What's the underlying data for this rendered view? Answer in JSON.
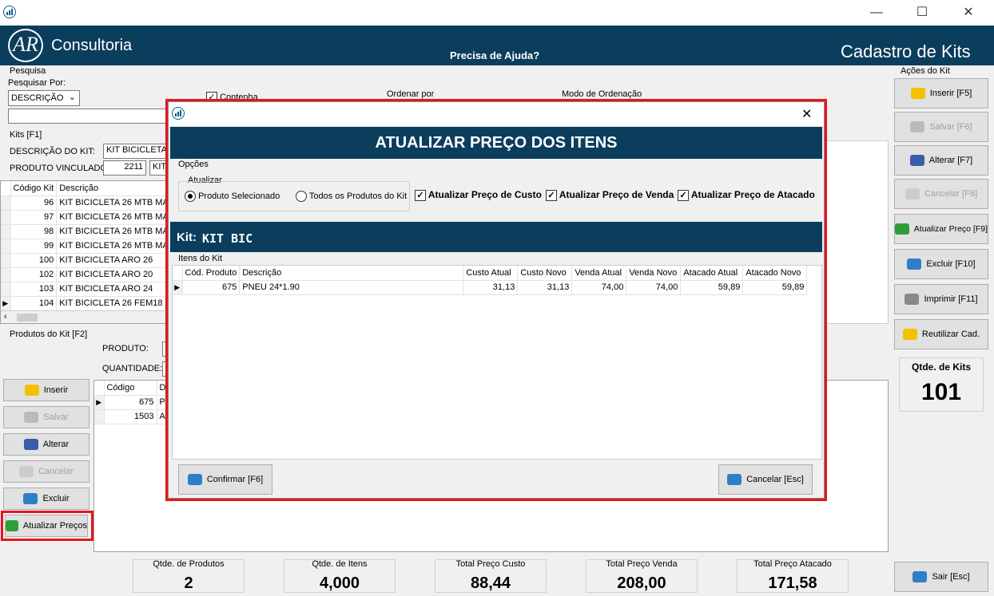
{
  "window": {
    "minimize": "—",
    "maximize": "☐",
    "close": "✕"
  },
  "header": {
    "brand": "Consultoria",
    "logo_text": "AR",
    "help": "Precisa de Ajuda?",
    "title": "Cadastro de Kits"
  },
  "search": {
    "group": "Pesquisa",
    "by_label": "Pesquisar Por:",
    "by_value": "DESCRIÇÃO",
    "contains_label": "Contenha",
    "order_label": "Ordenar por",
    "order_mode_label": "Modo de Ordenação"
  },
  "kits": {
    "group": "Kits [F1]",
    "desc_label": "DESCRIÇÃO DO KIT:",
    "desc_value": "KIT BICICLETA 2",
    "prod_label": "PRODUTO VINCULADO:",
    "prod_code": "2211",
    "prod_desc": "KIT",
    "columns": [
      "Código Kit",
      "Descrição"
    ],
    "rows": [
      {
        "code": "96",
        "desc": "KIT BICICLETA 26 MTB MASC"
      },
      {
        "code": "97",
        "desc": "KIT BICICLETA 26 MTB MASC"
      },
      {
        "code": "98",
        "desc": "KIT BICICLETA 26 MTB MASC"
      },
      {
        "code": "99",
        "desc": "KIT BICICLETA 26 MTB MASC"
      },
      {
        "code": "100",
        "desc": "KIT BICICLETA ARO 26"
      },
      {
        "code": "102",
        "desc": "KIT BICICLETA ARO 20"
      },
      {
        "code": "103",
        "desc": "KIT BICICLETA ARO 24"
      },
      {
        "code": "104",
        "desc": "KIT BICICLETA 26 FEM18 MA"
      }
    ]
  },
  "products": {
    "group": "Produtos do Kit [F2]",
    "product_label": "PRODUTO:",
    "qty_label": "QUANTIDADE:",
    "columns": [
      "Código",
      "De"
    ],
    "rows": [
      {
        "code": "675",
        "desc": "PN"
      },
      {
        "code": "1503",
        "desc": "AR"
      }
    ]
  },
  "left_buttons": {
    "insert": "Inserir",
    "save": "Salvar",
    "edit": "Alterar",
    "cancel": "Cancelar",
    "delete": "Excluir",
    "update_prices": "Atualizar Preços"
  },
  "actions": {
    "group": "Ações do Kit",
    "insert": "Inserir    [F5]",
    "save": "Salvar     [F6]",
    "edit": "Alterar    [F7]",
    "cancel": "Cancelar [F8]",
    "update_price": "Atualizar Preço [F9]",
    "delete": "Excluir    [F10]",
    "print": "Imprimir [F11]",
    "reuse": "Reutilizar Cad.",
    "qty_label": "Qtde. de Kits",
    "qty_value": "101",
    "exit": "Sair [Esc]"
  },
  "totals": [
    {
      "label": "Qtde. de Produtos",
      "value": "2"
    },
    {
      "label": "Qtde. de Itens",
      "value": "4,000"
    },
    {
      "label": "Total Preço Custo",
      "value": "88,44"
    },
    {
      "label": "Total Preço Venda",
      "value": "208,00"
    },
    {
      "label": "Total Preço Atacado",
      "value": "171,58"
    }
  ],
  "modal": {
    "close": "✕",
    "title": "ATUALIZAR PREÇO DOS ITENS",
    "options_label": "Opções",
    "update_label": "Atualizar",
    "radio_selected": "Produto Selecionado",
    "radio_all": "Todos os Produtos do Kit",
    "chk_cost": "Atualizar Preço de Custo",
    "chk_sale": "Atualizar Preço de Venda",
    "chk_wholesale": "Atualizar Preço de Atacado",
    "kit_label": "Kit:",
    "kit_value": "KIT BIC",
    "items_label": "Itens do Kit",
    "columns": [
      "Cód. Produto",
      "Descrição",
      "Custo Atual",
      "Custo Novo",
      "Venda Atual",
      "Venda Novo",
      "Atacado Atual",
      "Atacado Novo"
    ],
    "rows": [
      {
        "code": "675",
        "desc": "PNEU 24*1.90",
        "cost_cur": "31,13",
        "cost_new": "31,13",
        "sale_cur": "74,00",
        "sale_new": "74,00",
        "whole_cur": "59,89",
        "whole_new": "59,89"
      }
    ],
    "confirm": "Confirmar [F6]",
    "cancel": "Cancelar [Esc]"
  },
  "colors": {
    "header": "#0b3d5c",
    "highlight": "#e8141d"
  }
}
